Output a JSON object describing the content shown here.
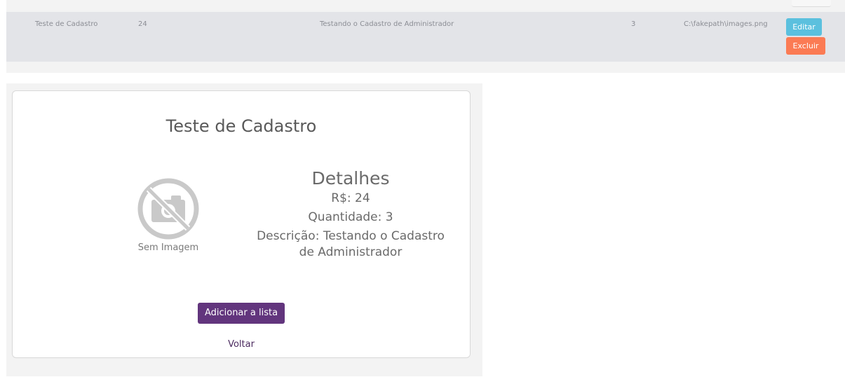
{
  "table": {
    "rows": [
      {
        "name": "Teste de Cadastro",
        "price": "24",
        "description": "Testando o Cadastro de Administrador",
        "quantity": "3",
        "image_path": "C:\\fakepath\\images.png",
        "edit_label": "Editar",
        "delete_label": "Excluir"
      }
    ]
  },
  "product": {
    "title": "Teste de Cadastro",
    "no_image_label": "Sem Imagem",
    "details_heading": "Detalhes",
    "price": "R$: 24",
    "quantity": "Quantidade: 3",
    "description": "Descrição: Testando o Cadastro de Administrador",
    "add_button_label": "Adicionar a lista",
    "back_link": "Voltar"
  },
  "colors": {
    "edit_button": "#5bc0de",
    "delete_button": "#fb7b54",
    "add_button": "#62357d"
  },
  "icons": {
    "no_image": "no-camera-icon"
  }
}
